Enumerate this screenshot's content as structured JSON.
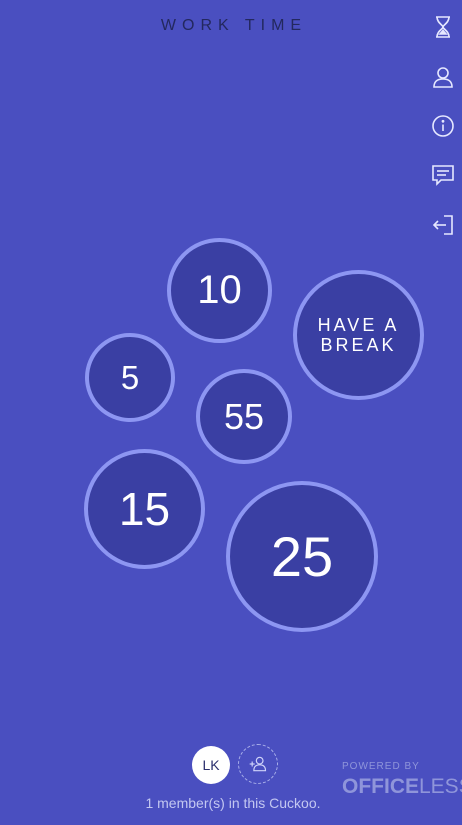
{
  "header": {
    "title": "WORK TIME"
  },
  "sidebar": {
    "items": [
      {
        "name": "timer",
        "icon": "hourglass-icon"
      },
      {
        "name": "profile",
        "icon": "user-icon"
      },
      {
        "name": "info",
        "icon": "info-icon"
      },
      {
        "name": "feedback",
        "icon": "chat-icon"
      },
      {
        "name": "logout",
        "icon": "sign-out-icon"
      }
    ]
  },
  "timers": {
    "t10": "10",
    "t5": "5",
    "t55": "55",
    "t15": "15",
    "t25": "25",
    "break_label": "HAVE A BREAK"
  },
  "footer": {
    "avatar_initials": "LK",
    "members_text": "1 member(s) in this Cuckoo.",
    "powered_by": "POWERED BY",
    "brand_bold": "OFFICE",
    "brand_light": "LESS"
  },
  "colors": {
    "background": "#4a4fc0",
    "bubble_fill": "#3a3fa3",
    "bubble_border": "#8d96f2",
    "title_text": "#23285e"
  }
}
